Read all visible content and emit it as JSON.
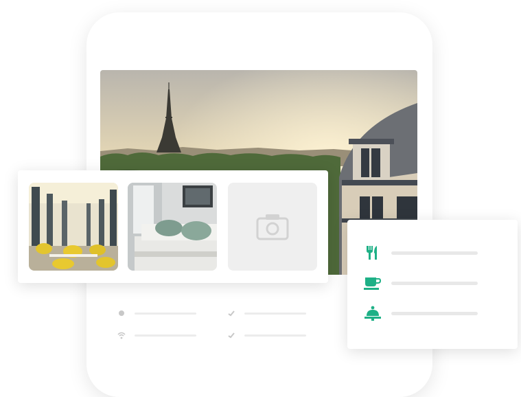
{
  "illustration": {
    "hero_photo": "eiffel-tower-rooftop-sunset",
    "gallery": {
      "thumbnails": [
        "restaurant-photo",
        "hotel-room-photo",
        "photo-placeholder"
      ],
      "placeholder_icon": "camera-icon"
    },
    "amenities": {
      "icons": [
        "restaurant-icon",
        "coffee-cup-icon",
        "room-service-icon"
      ],
      "accent_color": "#1eb086"
    },
    "feature_icons": [
      "amenity-dot-icon",
      "check-icon",
      "wifi-icon",
      "check-icon"
    ]
  }
}
